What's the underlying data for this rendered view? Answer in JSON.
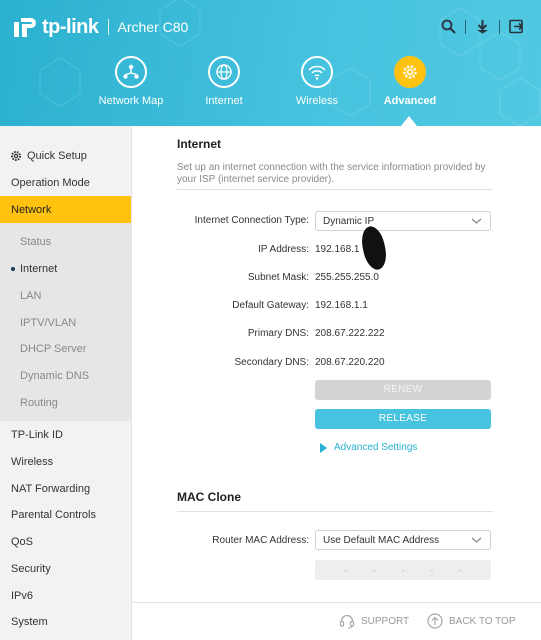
{
  "header": {
    "brand": "tp-link",
    "model": "Archer C80",
    "icons": [
      "search-icon",
      "download-icon",
      "logout-icon"
    ]
  },
  "nav": {
    "items": [
      {
        "label": "Network Map",
        "icon": "network-map-icon"
      },
      {
        "label": "Internet",
        "icon": "globe-icon"
      },
      {
        "label": "Wireless",
        "icon": "wifi-icon"
      },
      {
        "label": "Advanced",
        "icon": "gear-icon",
        "active": true
      }
    ]
  },
  "sidebar": {
    "items": [
      {
        "label": "Quick Setup",
        "icon": "gear-icon"
      },
      {
        "label": "Operation Mode"
      },
      {
        "label": "Network",
        "active": true
      },
      {
        "label": "Status"
      },
      {
        "label": "Internet",
        "current": true
      },
      {
        "label": "LAN"
      },
      {
        "label": "IPTV/VLAN"
      },
      {
        "label": "DHCP Server"
      },
      {
        "label": "Dynamic DNS"
      },
      {
        "label": "Routing"
      },
      {
        "label": "TP-Link ID"
      },
      {
        "label": "Wireless"
      },
      {
        "label": "NAT Forwarding"
      },
      {
        "label": "Parental Controls"
      },
      {
        "label": "QoS"
      },
      {
        "label": "Security"
      },
      {
        "label": "IPv6"
      },
      {
        "label": "System"
      }
    ]
  },
  "internet": {
    "title": "Internet",
    "description": "Set up an internet connection with the service information provided by your ISP (internet service provider).",
    "connection_type_label": "Internet Connection Type:",
    "connection_type_value": "Dynamic IP",
    "ip_label": "IP Address:",
    "ip_value": "192.168.1",
    "subnet_label": "Subnet Mask:",
    "subnet_value": "255.255.255.0",
    "gateway_label": "Default Gateway:",
    "gateway_value": "192.168.1.1",
    "dns1_label": "Primary DNS:",
    "dns1_value": "208.67.222.222",
    "dns2_label": "Secondary DNS:",
    "dns2_value": "208.67.220.220",
    "renew_label": "RENEW",
    "release_label": "RELEASE",
    "advanced_label": "Advanced Settings"
  },
  "mac_clone": {
    "title": "MAC Clone",
    "router_mac_label": "Router MAC Address:",
    "router_mac_value": "Use Default MAC Address",
    "mac_separators": [
      "-",
      "-",
      "-",
      "-",
      "-"
    ]
  },
  "footer": {
    "support_label": "SUPPORT",
    "back_to_top_label": "BACK TO TOP"
  },
  "colors": {
    "accent": "#46c3df",
    "active": "#ffc20e"
  }
}
